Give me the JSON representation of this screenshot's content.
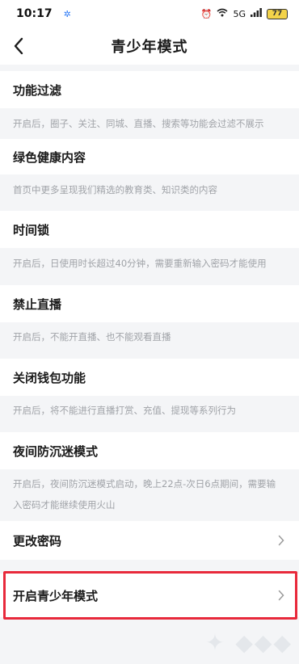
{
  "status": {
    "time": "10:17",
    "battery": "77",
    "network": "5G"
  },
  "header": {
    "title": "青少年模式"
  },
  "sections": [
    {
      "title": "功能过滤",
      "desc": "开启后，圈子、关注、同城、直播、搜索等功能会过滤不展示"
    },
    {
      "title": "绿色健康内容",
      "desc": "首页中更多呈现我们精选的教育类、知识类的内容"
    },
    {
      "title": "时间锁",
      "desc": "开启后，日使用时长超过40分钟，需要重新输入密码才能使用"
    },
    {
      "title": "禁止直播",
      "desc": "开启后，不能开直播、也不能观看直播"
    },
    {
      "title": "关闭钱包功能",
      "desc": "开启后，将不能进行直播打赏、充值、提现等系列行为"
    },
    {
      "title": "夜间防沉迷模式",
      "desc_line1": "开启后，夜间防沉迷模式启动，晚上22点-次日6点期间，需要输",
      "desc_line2": "入密码才能继续使用火山"
    }
  ],
  "actions": {
    "change_password": "更改密码",
    "enable_teen_mode": "开启青少年模式"
  },
  "colors": {
    "highlight": "#e8293b",
    "background": "#f4f5f7",
    "desc_text": "#a0a3a8"
  }
}
